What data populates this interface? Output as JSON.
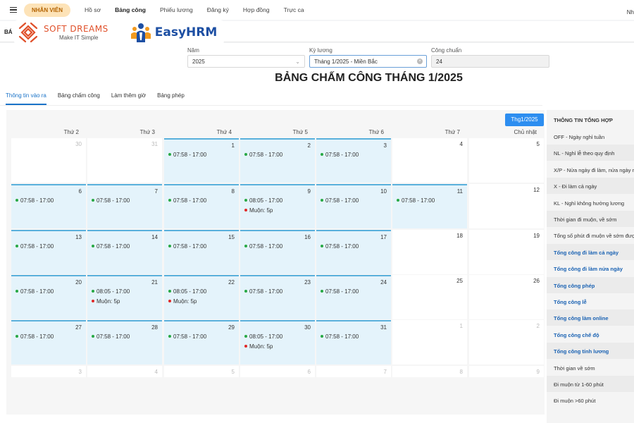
{
  "topbar": {
    "pill": "NHÂN VIÊN",
    "nav": [
      {
        "label": "Hồ sơ",
        "active": false
      },
      {
        "label": "Bảng công",
        "active": true
      },
      {
        "label": "Phiếu lương",
        "active": false
      },
      {
        "label": "Đăng ký",
        "active": false
      },
      {
        "label": "Hợp đồng",
        "active": false
      },
      {
        "label": "Trực ca",
        "active": false
      }
    ],
    "user_short": "Nh"
  },
  "subheader": {
    "code": "BÁ"
  },
  "logos": {
    "softdreams_name": "SOFT DREAMS",
    "softdreams_tagline": "Make IT Simple",
    "easyhrm_name": "EasyHRM"
  },
  "filters": {
    "year_label": "Năm",
    "year_value": "2025",
    "period_label": "Kỳ lương",
    "period_value": "Tháng 1/2025 - Miền Bắc",
    "standard_label": "Công chuẩn",
    "standard_value": "24"
  },
  "page_title": "BẢNG CHẤM CÔNG THÁNG 1/2025",
  "tabs": [
    {
      "label": "Thông tin vào ra",
      "active": true
    },
    {
      "label": "Bảng chấm công",
      "active": false
    },
    {
      "label": "Làm thêm giờ",
      "active": false
    },
    {
      "label": "Bảng phép",
      "active": false
    }
  ],
  "month_button": "Thg1/2025",
  "weekdays": [
    "Thứ 2",
    "Thứ 3",
    "Thứ 4",
    "Thứ 5",
    "Thứ 6",
    "Thứ 7",
    "Chủ nhật"
  ],
  "calendar": {
    "weeks": [
      [
        {
          "day": "30",
          "other": true,
          "events": []
        },
        {
          "day": "31",
          "other": true,
          "events": []
        },
        {
          "day": "1",
          "worked": true,
          "events": [
            {
              "text": "07:58 - 17:00",
              "color": "green"
            }
          ]
        },
        {
          "day": "2",
          "worked": true,
          "events": [
            {
              "text": "07:58 - 17:00",
              "color": "green"
            }
          ]
        },
        {
          "day": "3",
          "worked": true,
          "events": [
            {
              "text": "07:58 - 17:00",
              "color": "green"
            }
          ]
        },
        {
          "day": "4",
          "events": []
        },
        {
          "day": "5",
          "events": []
        }
      ],
      [
        {
          "day": "6",
          "worked": true,
          "events": [
            {
              "text": "07:58 - 17:00",
              "color": "green"
            }
          ]
        },
        {
          "day": "7",
          "worked": true,
          "events": [
            {
              "text": "07:58 - 17:00",
              "color": "green"
            }
          ]
        },
        {
          "day": "8",
          "worked": true,
          "events": [
            {
              "text": "07:58 - 17:00",
              "color": "green"
            }
          ]
        },
        {
          "day": "9",
          "worked": true,
          "events": [
            {
              "text": "08:05 - 17:00",
              "color": "green"
            },
            {
              "text": "Muộn: 5p",
              "color": "red"
            }
          ]
        },
        {
          "day": "10",
          "worked": true,
          "events": [
            {
              "text": "07:58 - 17:00",
              "color": "green"
            }
          ]
        },
        {
          "day": "11",
          "worked": true,
          "events": [
            {
              "text": "07:58 - 17:00",
              "color": "green"
            }
          ]
        },
        {
          "day": "12",
          "events": []
        }
      ],
      [
        {
          "day": "13",
          "worked": true,
          "events": [
            {
              "text": "07:58 - 17:00",
              "color": "green"
            }
          ]
        },
        {
          "day": "14",
          "worked": true,
          "events": [
            {
              "text": "07:58 - 17:00",
              "color": "green"
            }
          ]
        },
        {
          "day": "15",
          "worked": true,
          "events": [
            {
              "text": "07:58 - 17:00",
              "color": "green"
            }
          ]
        },
        {
          "day": "16",
          "worked": true,
          "events": [
            {
              "text": "07:58 - 17:00",
              "color": "green"
            }
          ]
        },
        {
          "day": "17",
          "worked": true,
          "events": [
            {
              "text": "07:58 - 17:00",
              "color": "green"
            }
          ]
        },
        {
          "day": "18",
          "events": []
        },
        {
          "day": "19",
          "events": []
        }
      ],
      [
        {
          "day": "20",
          "worked": true,
          "events": [
            {
              "text": "07:58 - 17:00",
              "color": "green"
            }
          ]
        },
        {
          "day": "21",
          "worked": true,
          "events": [
            {
              "text": "08:05 - 17:00",
              "color": "green"
            },
            {
              "text": "Muộn: 5p",
              "color": "red"
            }
          ]
        },
        {
          "day": "22",
          "worked": true,
          "events": [
            {
              "text": "08:05 - 17:00",
              "color": "green"
            },
            {
              "text": "Muộn: 5p",
              "color": "red"
            }
          ]
        },
        {
          "day": "23",
          "worked": true,
          "events": [
            {
              "text": "07:58 - 17:00",
              "color": "green"
            }
          ]
        },
        {
          "day": "24",
          "worked": true,
          "events": [
            {
              "text": "07:58 - 17:00",
              "color": "green"
            }
          ]
        },
        {
          "day": "25",
          "events": []
        },
        {
          "day": "26",
          "events": []
        }
      ],
      [
        {
          "day": "27",
          "worked": true,
          "events": [
            {
              "text": "07:58 - 17:00",
              "color": "green"
            }
          ]
        },
        {
          "day": "28",
          "worked": true,
          "events": [
            {
              "text": "07:58 - 17:00",
              "color": "green"
            }
          ]
        },
        {
          "day": "29",
          "worked": true,
          "events": [
            {
              "text": "07:58 - 17:00",
              "color": "green"
            }
          ]
        },
        {
          "day": "30",
          "worked": true,
          "events": [
            {
              "text": "08:05 - 17:00",
              "color": "green"
            },
            {
              "text": "Muộn: 5p",
              "color": "red"
            }
          ]
        },
        {
          "day": "31",
          "worked": true,
          "events": [
            {
              "text": "07:58 - 17:00",
              "color": "green"
            }
          ]
        },
        {
          "day": "1",
          "other": true,
          "events": []
        },
        {
          "day": "2",
          "other": true,
          "events": []
        }
      ],
      [
        {
          "day": "3",
          "other": true,
          "events": []
        },
        {
          "day": "4",
          "other": true,
          "events": []
        },
        {
          "day": "5",
          "other": true,
          "events": []
        },
        {
          "day": "6",
          "other": true,
          "events": []
        },
        {
          "day": "7",
          "other": true,
          "events": []
        },
        {
          "day": "8",
          "other": true,
          "events": []
        },
        {
          "day": "9",
          "other": true,
          "events": []
        }
      ]
    ]
  },
  "summary": {
    "title": "THÔNG TIN TỔNG HỢP",
    "items": [
      {
        "label": "OFF - Ngày nghỉ tuần",
        "blue": false
      },
      {
        "label": "NL - Nghỉ lễ theo quy định",
        "blue": false
      },
      {
        "label": "X/P - Nửa ngày đi làm, nửa ngày nghỉ",
        "blue": false
      },
      {
        "label": "X - Đi làm cả ngày",
        "blue": false
      },
      {
        "label": "KL - Nghỉ không hưởng lương",
        "blue": false
      },
      {
        "label": "Thời gian đi muộn, về sớm",
        "blue": false
      },
      {
        "label": "Tổng số phút đi muộn về sớm được",
        "blue": false
      },
      {
        "label": "Tổng công đi làm cả ngày",
        "blue": true
      },
      {
        "label": "Tổng công đi làm nửa ngày",
        "blue": true
      },
      {
        "label": "Tổng công phép",
        "blue": true
      },
      {
        "label": "Tổng công lễ",
        "blue": true
      },
      {
        "label": "Tổng công làm online",
        "blue": true
      },
      {
        "label": "Tổng công chế độ",
        "blue": true
      },
      {
        "label": "Tổng công tính lương",
        "blue": true
      },
      {
        "label": "Thời gian về sớm",
        "blue": false
      },
      {
        "label": "Đi muộn từ 1-60 phút",
        "blue": false
      },
      {
        "label": "Đi muộn >60 phút",
        "blue": false
      }
    ]
  },
  "colors": {
    "accent": "#2d8ef0",
    "worked_bg": "#e4f3fb",
    "present_dot": "#27a844",
    "late_dot": "#e02828",
    "pill_bg": "#fde3b8"
  }
}
